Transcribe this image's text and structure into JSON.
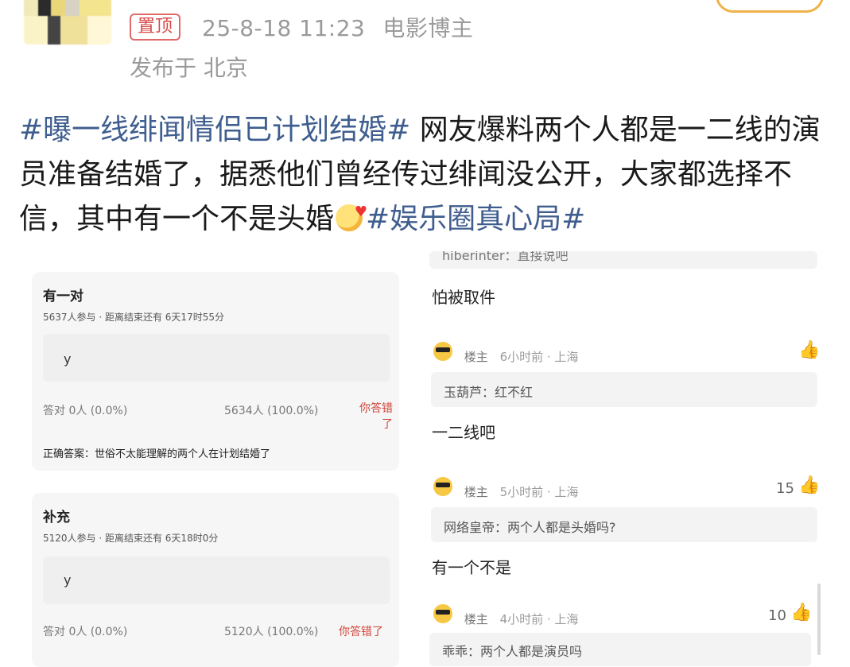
{
  "header": {
    "badge": "置顶",
    "timestamp": "25-8-18 11:23",
    "source": "电影博主",
    "location": "发布于 北京"
  },
  "post": {
    "tag1": "#曝一线绯闻情侣已计划结婚#",
    "text1": " 网友爆料两个人都是一二线的演员准备结婚了，据悉他们曾经传过绯闻没公开，大家都选择不信，其中有一个不是头婚",
    "tag2": "#娱乐圈真心局#"
  },
  "left_card": {
    "poll1": {
      "title": "有一对",
      "meta": "5637人参与 · 距离结束还有 6天17时55分",
      "option": "y",
      "correct_stat": "答对 0人 (0.0%)",
      "wrong_stat": "5634人 (100.0%)",
      "result": "你答错了",
      "answer": "正确答案：世俗不太能理解的两个人在计划结婚了"
    },
    "poll2": {
      "title": "补充",
      "meta": "5120人参与 · 距离结束还有 6天18时0分",
      "option": "y",
      "correct_stat": "答对 0人 (0.0%)",
      "wrong_stat": "5120人 (100.0%)",
      "result": "你答错了"
    }
  },
  "comments": {
    "top_cut": "hiberinter：直接说吧",
    "c1": {
      "text": "怕被取件",
      "user": "楼主",
      "time": "6小时前 · 上海",
      "reply": "玉葫芦：红不红",
      "likes": ""
    },
    "c2": {
      "text": "一二线吧",
      "user": "楼主",
      "time": "5小时前 · 上海",
      "reply": "网络皇帝：两个人都是头婚吗?",
      "likes": "15"
    },
    "c3": {
      "text": "有一个不是",
      "user": "楼主",
      "time": "4小时前 · 上海",
      "reply": "乖乖：两个人都是演员吗",
      "likes": "10"
    }
  },
  "icons": {
    "like": "thumbs-up-icon",
    "user_avatar": "sunglasses-emoji-icon",
    "post_emoji": "yummy-face-emoji"
  },
  "colors": {
    "tag": "#3f5e8f",
    "badge": "#d84a4a",
    "wrong": "#d0453a"
  }
}
